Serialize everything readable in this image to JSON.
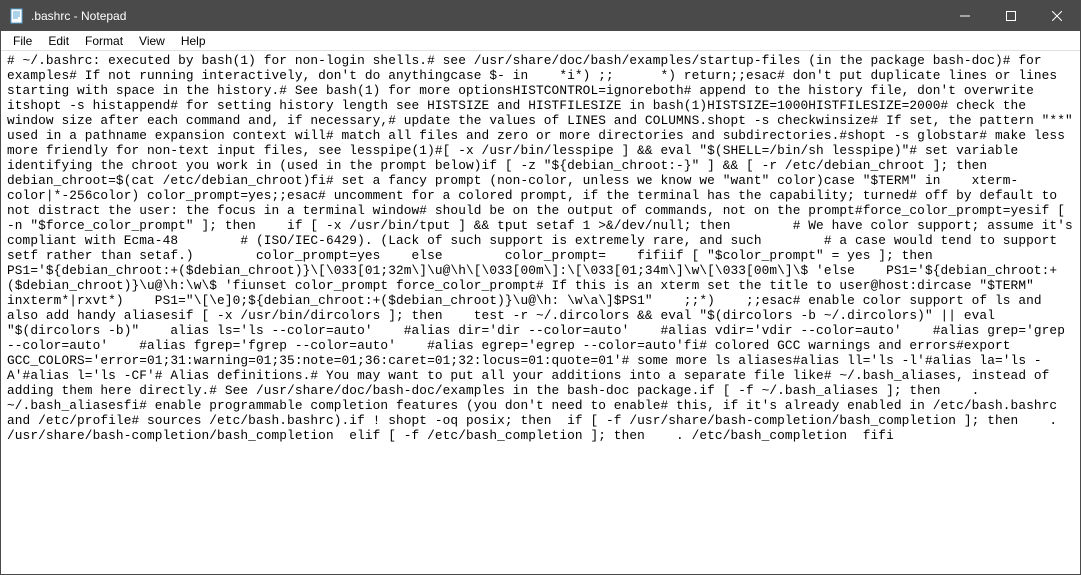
{
  "window": {
    "title": ".bashrc - Notepad"
  },
  "menubar": {
    "items": [
      "File",
      "Edit",
      "Format",
      "View",
      "Help"
    ]
  },
  "editor": {
    "content": "# ~/.bashrc: executed by bash(1) for non-login shells.# see /usr/share/doc/bash/examples/startup-files (in the package bash-doc)# for examples# If not running interactively, don't do anythingcase $- in    *i*) ;;      *) return;;esac# don't put duplicate lines or lines starting with space in the history.# See bash(1) for more optionsHISTCONTROL=ignoreboth# append to the history file, don't overwrite itshopt -s histappend# for setting history length see HISTSIZE and HISTFILESIZE in bash(1)HISTSIZE=1000HISTFILESIZE=2000# check the window size after each command and, if necessary,# update the values of LINES and COLUMNS.shopt -s checkwinsize# If set, the pattern \"**\" used in a pathname expansion context will# match all files and zero or more directories and subdirectories.#shopt -s globstar# make less more friendly for non-text input files, see lesspipe(1)#[ -x /usr/bin/lesspipe ] && eval \"$(SHELL=/bin/sh lesspipe)\"# set variable identifying the chroot you work in (used in the prompt below)if [ -z \"${debian_chroot:-}\" ] && [ -r /etc/debian_chroot ]; then    debian_chroot=$(cat /etc/debian_chroot)fi# set a fancy prompt (non-color, unless we know we \"want\" color)case \"$TERM\" in    xterm-color|*-256color) color_prompt=yes;;esac# uncomment for a colored prompt, if the terminal has the capability; turned# off by default to not distract the user: the focus in a terminal window# should be on the output of commands, not on the prompt#force_color_prompt=yesif [ -n \"$force_color_prompt\" ]; then    if [ -x /usr/bin/tput ] && tput setaf 1 >&/dev/null; then        # We have color support; assume it's compliant with Ecma-48        # (ISO/IEC-6429). (Lack of such support is extremely rare, and such        # a case would tend to support setf rather than setaf.)        color_prompt=yes    else        color_prompt=    fifiif [ \"$color_prompt\" = yes ]; then    PS1='${debian_chroot:+($debian_chroot)}\\[\\033[01;32m\\]\\u@\\h\\[\\033[00m\\]:\\[\\033[01;34m\\]\\w\\[\\033[00m\\]\\$ 'else    PS1='${debian_chroot:+($debian_chroot)}\\u@\\h:\\w\\$ 'fiunset color_prompt force_color_prompt# If this is an xterm set the title to user@host:dircase \"$TERM\" inxterm*|rxvt*)    PS1=\"\\[\\e]0;${debian_chroot:+($debian_chroot)}\\u@\\h: \\w\\a\\]$PS1\"    ;;*)    ;;esac# enable color support of ls and also add handy aliasesif [ -x /usr/bin/dircolors ]; then    test -r ~/.dircolors && eval \"$(dircolors -b ~/.dircolors)\" || eval \"$(dircolors -b)\"    alias ls='ls --color=auto'    #alias dir='dir --color=auto'    #alias vdir='vdir --color=auto'    #alias grep='grep --color=auto'    #alias fgrep='fgrep --color=auto'    #alias egrep='egrep --color=auto'fi# colored GCC warnings and errors#export GCC_COLORS='error=01;31:warning=01;35:note=01;36:caret=01;32:locus=01:quote=01'# some more ls aliases#alias ll='ls -l'#alias la='ls -A'#alias l='ls -CF'# Alias definitions.# You may want to put all your additions into a separate file like# ~/.bash_aliases, instead of adding them here directly.# See /usr/share/doc/bash-doc/examples in the bash-doc package.if [ -f ~/.bash_aliases ]; then    . ~/.bash_aliasesfi# enable programmable completion features (you don't need to enable# this, if it's already enabled in /etc/bash.bashrc and /etc/profile# sources /etc/bash.bashrc).if ! shopt -oq posix; then  if [ -f /usr/share/bash-completion/bash_completion ]; then    . /usr/share/bash-completion/bash_completion  elif [ -f /etc/bash_completion ]; then    . /etc/bash_completion  fifi"
  }
}
